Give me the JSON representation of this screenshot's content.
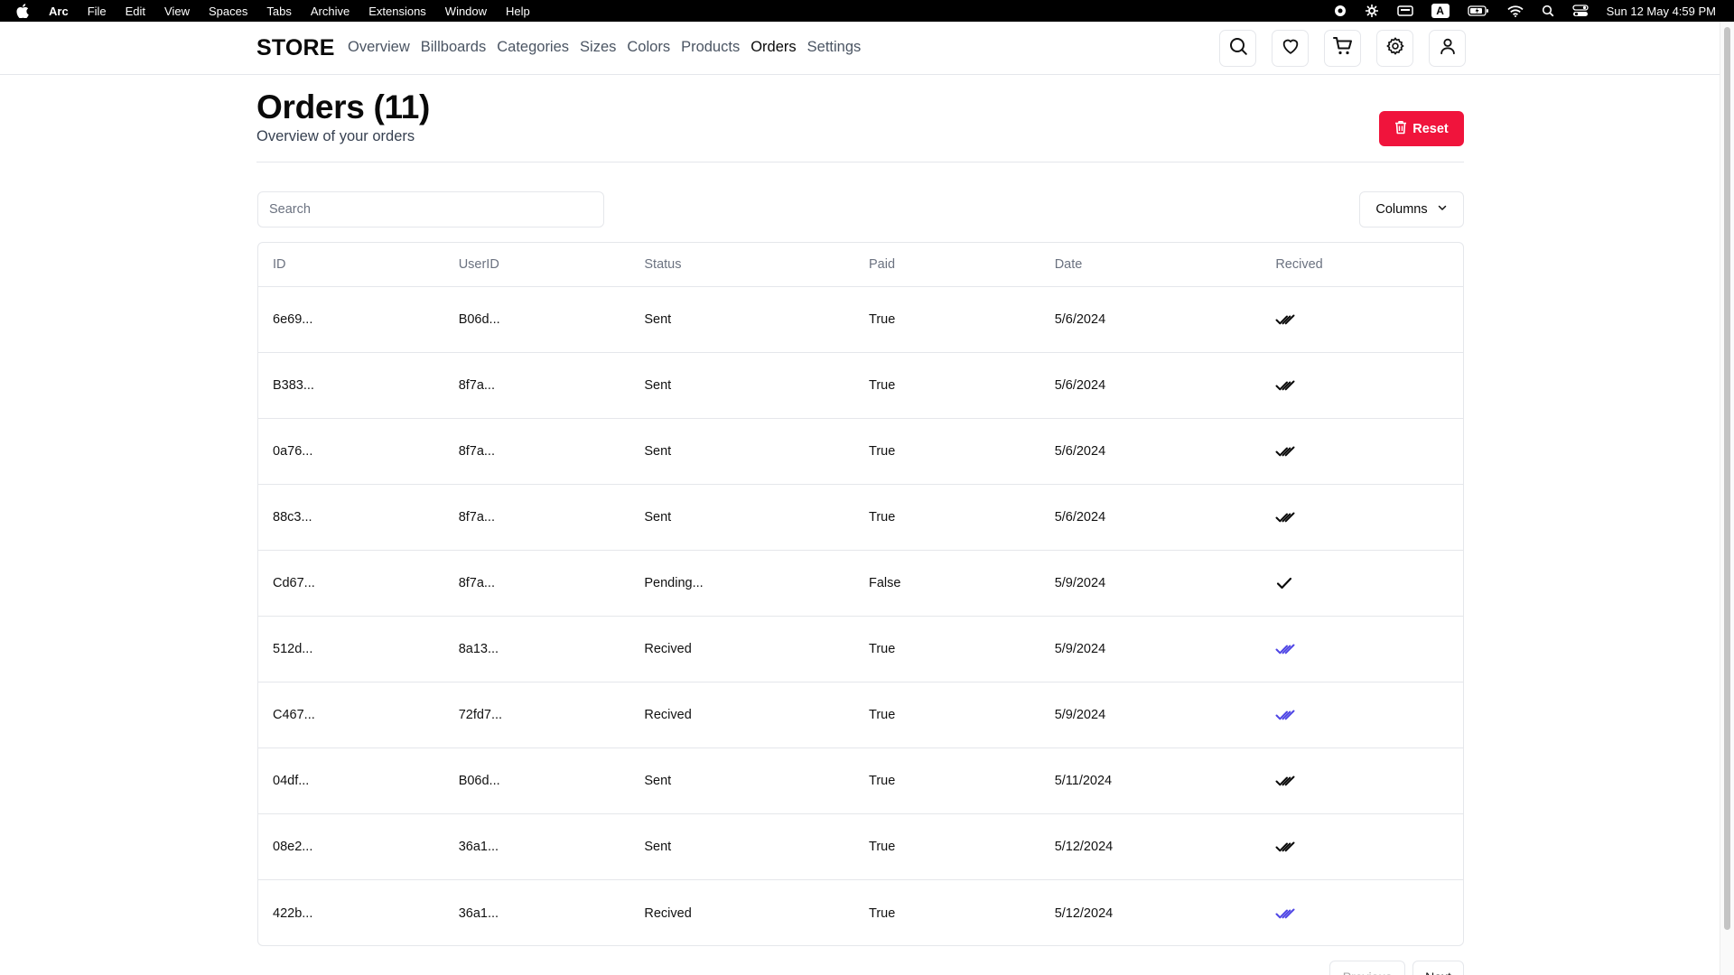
{
  "menubar": {
    "app_name": "Arc",
    "items": [
      "File",
      "Edit",
      "View",
      "Spaces",
      "Tabs",
      "Archive",
      "Extensions",
      "Window",
      "Help"
    ],
    "clock": "Sun 12 May  4:59 PM",
    "keyboard_indicator": "A"
  },
  "header": {
    "brand": "STORE",
    "nav": [
      "Overview",
      "Billboards",
      "Categories",
      "Sizes",
      "Colors",
      "Products",
      "Orders",
      "Settings"
    ],
    "active_nav": "Orders"
  },
  "page": {
    "title": "Orders (11)",
    "subtitle": "Overview of your orders",
    "reset_label": "Reset"
  },
  "toolbar": {
    "search_placeholder": "Search",
    "columns_label": "Columns"
  },
  "table": {
    "headers": [
      "ID",
      "UserID",
      "Status",
      "Paid",
      "Date",
      "Recived"
    ],
    "rows": [
      {
        "id": "6e69...",
        "user": "B06d...",
        "status": "Sent",
        "paid": "True",
        "date": "5/6/2024",
        "received_icon": "double-check"
      },
      {
        "id": "B383...",
        "user": "8f7a...",
        "status": "Sent",
        "paid": "True",
        "date": "5/6/2024",
        "received_icon": "double-check"
      },
      {
        "id": "0a76...",
        "user": "8f7a...",
        "status": "Sent",
        "paid": "True",
        "date": "5/6/2024",
        "received_icon": "double-check"
      },
      {
        "id": "88c3...",
        "user": "8f7a...",
        "status": "Sent",
        "paid": "True",
        "date": "5/6/2024",
        "received_icon": "double-check"
      },
      {
        "id": "Cd67...",
        "user": "8f7a...",
        "status": "Pending...",
        "paid": "False",
        "date": "5/9/2024",
        "received_icon": "single-check"
      },
      {
        "id": "512d...",
        "user": "8a13...",
        "status": "Recived",
        "paid": "True",
        "date": "5/9/2024",
        "received_icon": "double-check-blue"
      },
      {
        "id": "C467...",
        "user": "72fd7...",
        "status": "Recived",
        "paid": "True",
        "date": "5/9/2024",
        "received_icon": "double-check-blue"
      },
      {
        "id": "04df...",
        "user": "B06d...",
        "status": "Sent",
        "paid": "True",
        "date": "5/11/2024",
        "received_icon": "double-check"
      },
      {
        "id": "08e2...",
        "user": "36a1...",
        "status": "Sent",
        "paid": "True",
        "date": "5/12/2024",
        "received_icon": "double-check"
      },
      {
        "id": "422b...",
        "user": "36a1...",
        "status": "Recived",
        "paid": "True",
        "date": "5/12/2024",
        "received_icon": "double-check-blue"
      }
    ]
  },
  "pagination": {
    "previous_label": "Previous",
    "next_label": "Next"
  },
  "colors": {
    "reset_red": "#f0143c",
    "received_blue": "#4f46e5",
    "text_dark": "#0a0a0a",
    "muted": "#6b7280",
    "border": "#e5e7eb"
  }
}
